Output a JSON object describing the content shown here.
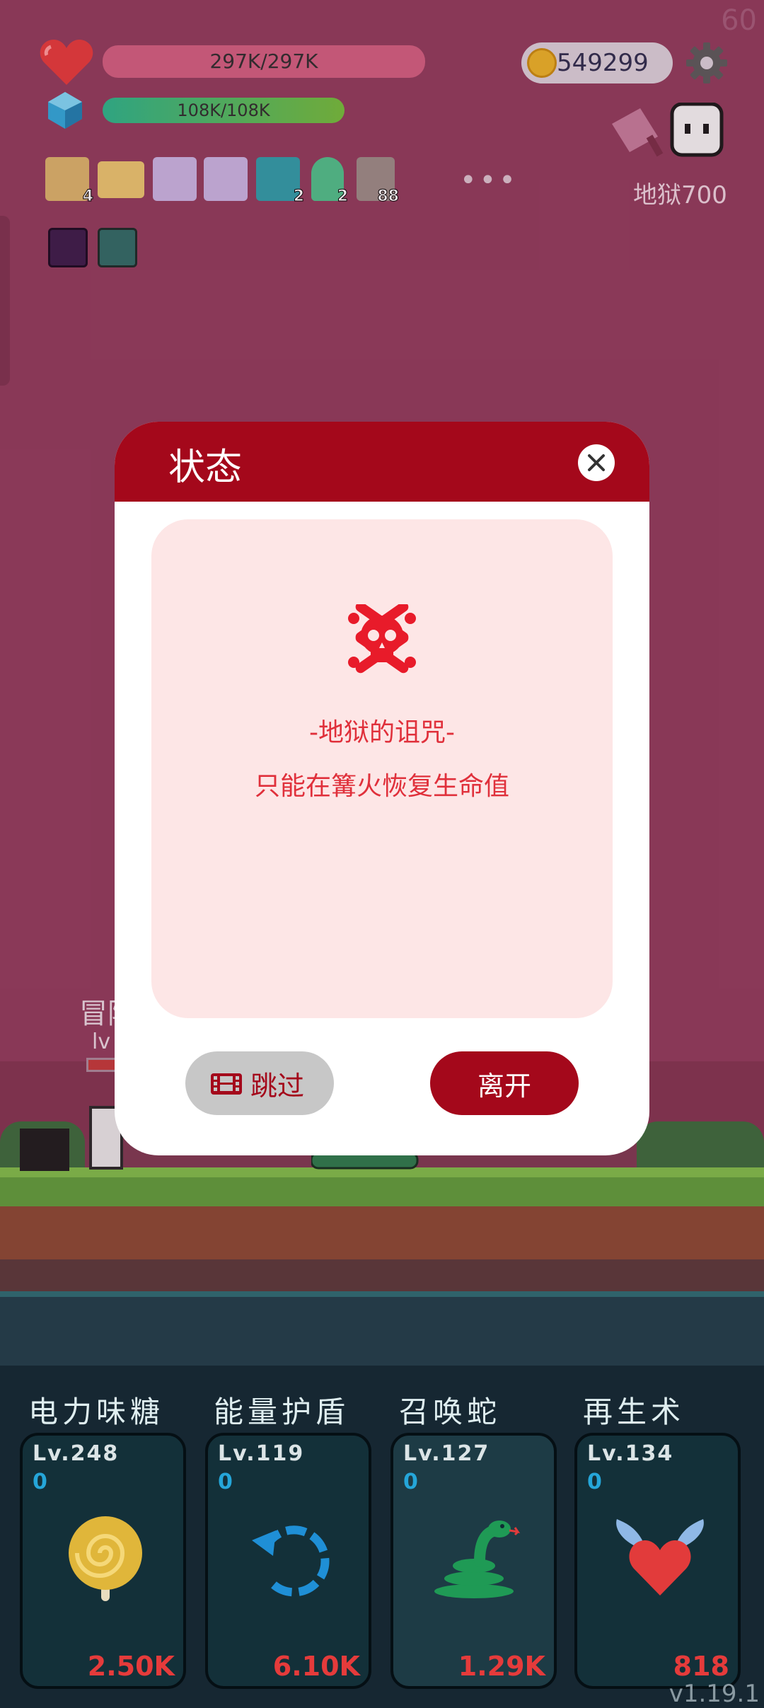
{
  "hud": {
    "fps": "60",
    "hp_text": "297K/297K",
    "mp_text": "108K/108K",
    "coins": "549299",
    "hell_label": "地狱700",
    "buff_counts": [
      "4",
      "2",
      "2",
      "88"
    ],
    "more": "•••"
  },
  "hero": {
    "name": "冒险",
    "lv": "lv"
  },
  "modal": {
    "title": "状态",
    "curse_title": "-地狱的诅咒-",
    "curse_desc": "只能在篝火恢复生命值",
    "skip_label": "跳过",
    "leave_label": "离开"
  },
  "skills": [
    {
      "name": "电力味糖",
      "lv": "Lv.248",
      "count": "0",
      "cost": "2.50K",
      "icon": "lollipop-icon"
    },
    {
      "name": "能量护盾",
      "lv": "Lv.119",
      "count": "0",
      "cost": "6.10K",
      "icon": "shield-rotate-icon"
    },
    {
      "name": "召唤蛇",
      "lv": "Lv.127",
      "count": "0",
      "cost": "1.29K",
      "icon": "snake-icon"
    },
    {
      "name": "再生术",
      "lv": "Lv.134",
      "count": "0",
      "cost": "818",
      "icon": "winged-heart-icon"
    }
  ],
  "version": "v1.19.1",
  "colors": {
    "sky": "#8f3d5c",
    "modal_header": "#a4081b",
    "curse_text": "#e0303b",
    "skill_cost": "#e53b3b"
  }
}
